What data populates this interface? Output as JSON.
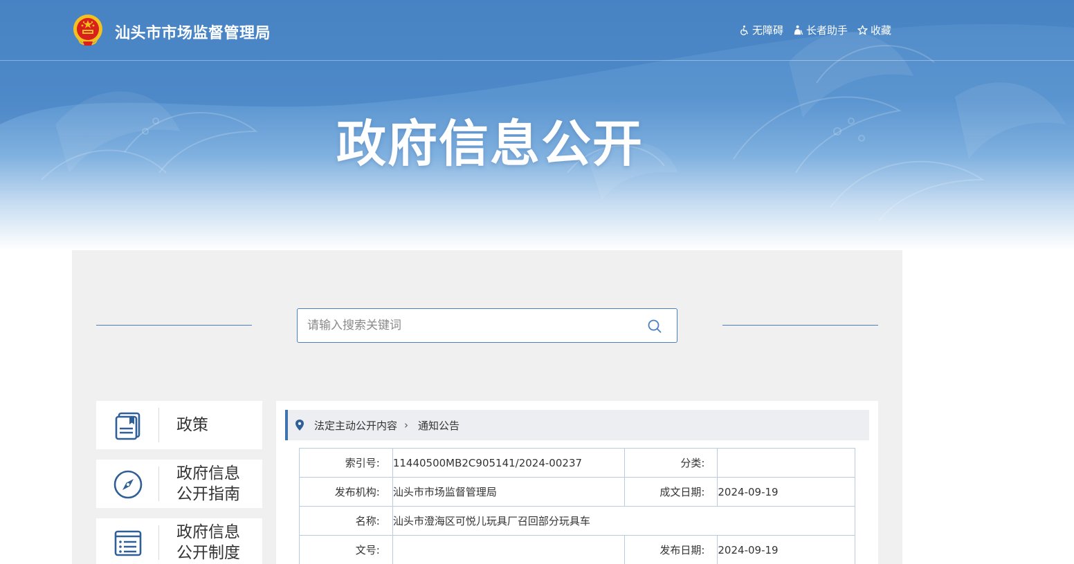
{
  "header": {
    "site_title": "汕头市市场监督管理局",
    "tools": [
      {
        "icon": "accessibility-icon",
        "label": "无障碍"
      },
      {
        "icon": "elder-assistant-icon",
        "label": "长者助手"
      },
      {
        "icon": "star-icon",
        "label": "收藏"
      }
    ]
  },
  "hero": {
    "title": "政府信息公开"
  },
  "search": {
    "placeholder": "请输入搜索关键词"
  },
  "sidebar": {
    "items": [
      {
        "icon": "policy-document-icon",
        "label": "政策"
      },
      {
        "icon": "compass-icon",
        "label": "政府信息\n公开指南"
      },
      {
        "icon": "list-document-icon",
        "label": "政府信息\n公开制度"
      }
    ]
  },
  "breadcrumb": {
    "items": [
      "法定主动公开内容",
      "通知公告"
    ]
  },
  "info_table": {
    "index_label": "索引号:",
    "index_value": "11440500MB2C905141/2024-00237",
    "category_label": "分类:",
    "category_value": "",
    "publisher_label": "发布机构:",
    "publisher_value": "汕头市市场监督管理局",
    "written_date_label": "成文日期:",
    "written_date_value": "2024-09-19",
    "name_label": "名称:",
    "name_value": "汕头市澄海区可悦儿玩具厂召回部分玩具车",
    "doc_no_label": "文号:",
    "doc_no_value": "",
    "publish_date_label": "发布日期:",
    "publish_date_value": "2024-09-19"
  },
  "colors": {
    "accent": "#3e73b0",
    "banner_blue": "#5b95d0",
    "panel_bg": "#f0f0f0",
    "table_border": "#b9cbe3"
  }
}
